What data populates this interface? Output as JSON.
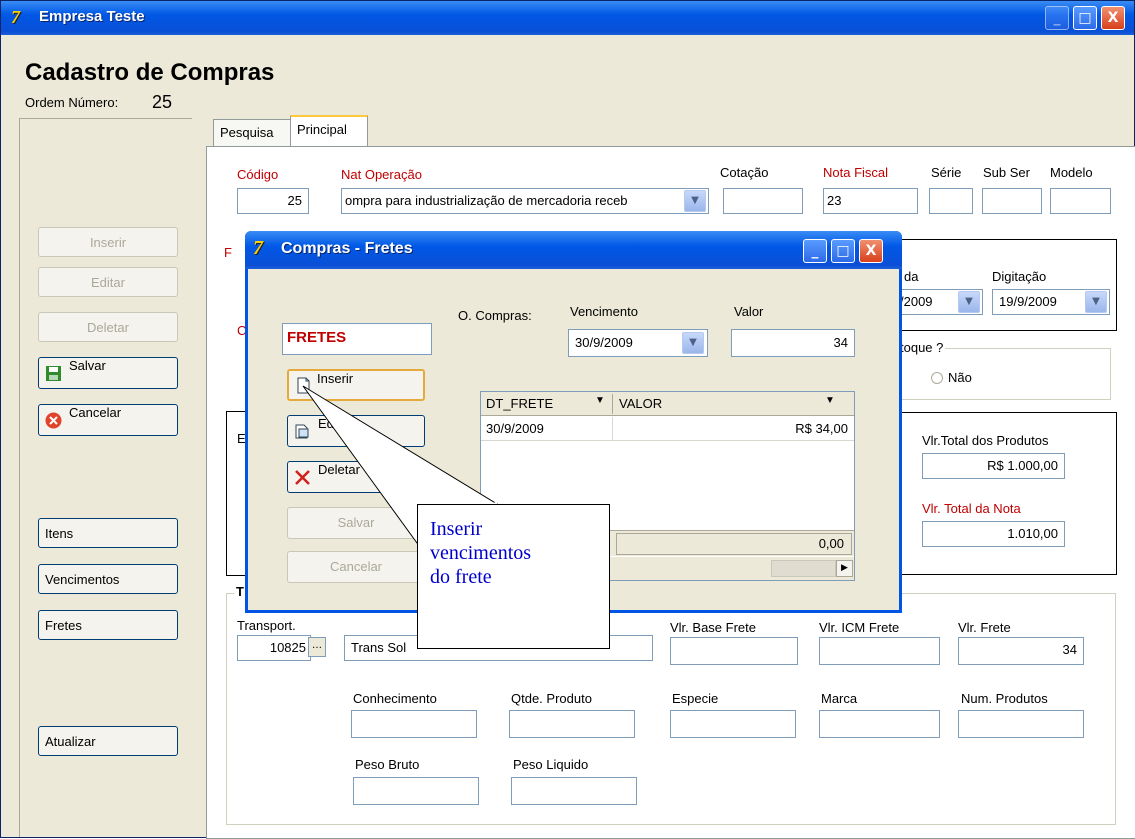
{
  "window": {
    "title": "Empresa Teste",
    "minimize": "_",
    "maximize": "□",
    "close": "X"
  },
  "header": {
    "title": "Cadastro de Compras",
    "ordem_label": "Ordem Número:",
    "ordem_value": "25"
  },
  "sidebar": {
    "inserir": "Inserir",
    "editar": "Editar",
    "deletar": "Deletar",
    "salvar": "Salvar",
    "cancelar": "Cancelar",
    "itens": "Itens",
    "vencimentos": "Vencimentos",
    "fretes": "Fretes",
    "atualizar": "Atualizar"
  },
  "tabs": {
    "pesquisa": "Pesquisa",
    "principal": "Principal"
  },
  "form": {
    "codigo_label": "Código",
    "codigo_value": "25",
    "natop_label": "Nat Operação",
    "natop_value": "ompra para industrialização de mercadoria receb",
    "cotacao_label": "Cotação",
    "cotacao_value": "",
    "nota_label": "Nota Fiscal",
    "nota_value": "23",
    "serie_label": "Série",
    "subser_label": "Sub Ser",
    "modelo_label": "Modelo",
    "entrada_label": "da",
    "entrada_value": "/2009",
    "digitacao_label": "Digitação",
    "digitacao_value": "19/9/2009",
    "estoque_label": "toque ?",
    "nao_label": "Não",
    "vlr_total_prod_label": "Vlr.Total dos Produtos",
    "vlr_total_prod_value": "R$ 1.000,00",
    "vlr_total_nota_label": "Vlr. Total da Nota",
    "vlr_total_nota_value": "1.010,00",
    "transp_section": "T",
    "transport_label": "Transport.",
    "transport_code": "10825",
    "transport_name": "Trans Sol",
    "vlr_base_frete_label": "Vlr. Base Frete",
    "vlr_icm_frete_label": "Vlr. ICM Frete",
    "vlr_frete_label": "Vlr. Frete",
    "vlr_frete_value": "34",
    "conhecimento_label": "Conhecimento",
    "qtde_produto_label": "Qtde. Produto",
    "especie_label": "Especie",
    "marca_label": "Marca",
    "num_produtos_label": "Num. Produtos",
    "peso_bruto_label": "Peso Bruto",
    "peso_liquido_label": "Peso Liquido",
    "left_frag_r": "F",
    "left_frag_c": "C",
    "left_frag_e": "E"
  },
  "dialog": {
    "title": "Compras - Fretes",
    "fretes_label": "FRETES",
    "ocompras_label": "O. Compras:",
    "vencimento_label": "Vencimento",
    "vencimento_value": "30/9/2009",
    "valor_label": "Valor",
    "valor_value": "34",
    "inserir": "Inserir",
    "editar": "Editar",
    "deletar": "Deletar",
    "salvar": "Salvar",
    "cancelar": "Cancelar",
    "grid": {
      "col1": "DT_FRETE",
      "col2": "VALOR",
      "rows": [
        {
          "dt": "30/9/2009",
          "valor": "R$ 34,00"
        }
      ],
      "total": "0,00"
    }
  },
  "callout": {
    "line1": "Inserir",
    "line2": "vencimentos",
    "line3": "do frete"
  }
}
